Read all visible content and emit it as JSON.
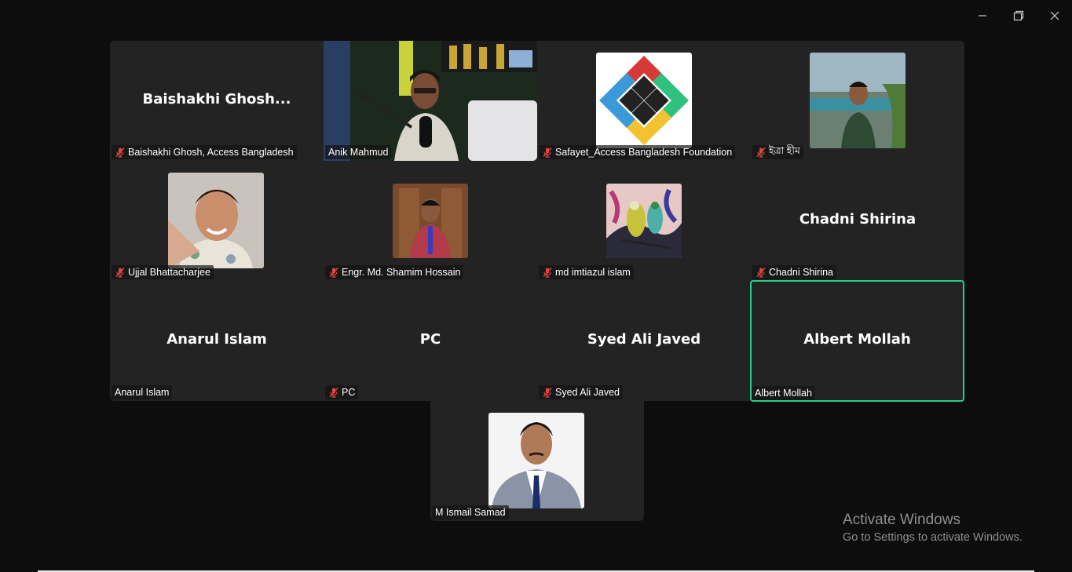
{
  "window": {
    "controls": {
      "minimize": "minimize",
      "maximize": "restore",
      "close": "close"
    }
  },
  "participants": [
    {
      "display": "Baishakhi  Ghosh...",
      "label": "Baishakhi Ghosh, Access Bangladesh",
      "muted": true
    },
    {
      "display": "",
      "label": "Anik Mahmud",
      "muted": false,
      "video": true
    },
    {
      "display": "",
      "label": "Safayet_Access Bangladesh Foundation",
      "muted": true,
      "avatar": "logo"
    },
    {
      "display": "",
      "label": "ইত্রা হীম",
      "muted": true,
      "avatar": "photo"
    },
    {
      "display": "",
      "label": "Ujjal Bhattacharjee",
      "muted": true,
      "avatar": "photo"
    },
    {
      "display": "",
      "label": "Engr. Md. Shamim Hossain",
      "muted": true,
      "avatar": "photo"
    },
    {
      "display": "",
      "label": "md imtiazul islam",
      "muted": true,
      "avatar": "art"
    },
    {
      "display": "Chadni Shirina",
      "label": "Chadni Shirina",
      "muted": true
    },
    {
      "display": "Anarul Islam",
      "label": "Anarul Islam",
      "muted": false
    },
    {
      "display": "PC",
      "label": "PC",
      "muted": true
    },
    {
      "display": "Syed Ali Javed",
      "label": "Syed Ali Javed",
      "muted": true
    },
    {
      "display": "Albert Mollah",
      "label": "Albert Mollah",
      "muted": false,
      "speaking": true
    },
    {
      "display": "",
      "label": "M Ismail Samad",
      "muted": false,
      "avatar": "photo"
    }
  ],
  "watermark": {
    "line1": "Activate Windows",
    "line2": "Go to Settings to activate Windows."
  },
  "colors": {
    "active_speaker": "#23d18b",
    "mute": "#e0463f",
    "tile_bg": "#232323"
  }
}
